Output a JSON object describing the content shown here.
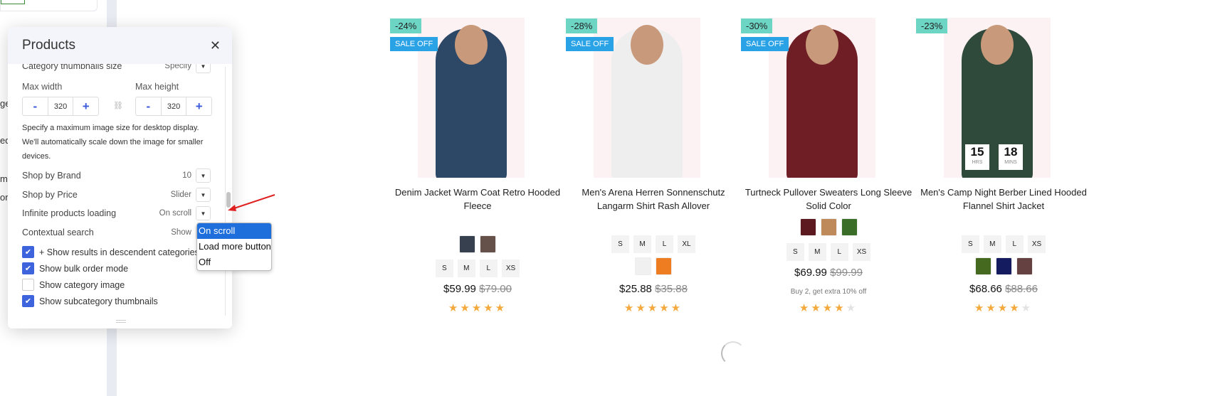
{
  "sidebar_fragments": [
    "ge",
    "ed",
    "me",
    "ori"
  ],
  "panel": {
    "title": "Products",
    "thumb_size": {
      "label": "Category thumbnails size",
      "value": "Specify"
    },
    "max_width": {
      "label": "Max width",
      "value": "320"
    },
    "max_height": {
      "label": "Max height",
      "value": "320"
    },
    "minus": "-",
    "plus": "+",
    "help": "Specify a maximum image size for desktop display. We'll automatically scale down the image for smaller devices.",
    "rows": [
      {
        "label": "Shop by Brand",
        "value": "10"
      },
      {
        "label": "Shop by Price",
        "value": "Slider"
      },
      {
        "label": "Infinite products loading",
        "value": "On scroll"
      },
      {
        "label": "Contextual search",
        "value": "Show"
      }
    ],
    "checks": [
      {
        "label": "+ Show results in descendent categories",
        "checked": true
      },
      {
        "label": "Show bulk order mode",
        "checked": true
      },
      {
        "label": "Show category image",
        "checked": false
      },
      {
        "label": "Show subcategory thumbnails",
        "checked": true
      }
    ],
    "dropdown_options": [
      "On scroll",
      "Load more button",
      "Off"
    ],
    "dropdown_selected": "On scroll"
  },
  "colors": {
    "accent": "#3d63dd",
    "discount_badge": "#6dd5c4",
    "sale_badge": "#2aa2e6",
    "star": "#f4a93c",
    "selected_option": "#1e6fdc"
  },
  "products": [
    {
      "discount": "-24%",
      "sale": "SALE OFF",
      "name": "Denim Jacket Warm Coat Retro Hooded Fleece",
      "colors": [
        "#36404f",
        "#65504a"
      ],
      "sizes": [
        "S",
        "M",
        "L",
        "XS"
      ],
      "order": "colors-first",
      "price": "$59.99",
      "old_price": "$79.00",
      "rating": 5,
      "garment": "#2d4766"
    },
    {
      "discount": "-28%",
      "sale": "SALE OFF",
      "name": "Men's Arena Herren Sonnenschutz Langarm Shirt Rash Allover",
      "sizes": [
        "S",
        "M",
        "L",
        "XL"
      ],
      "colors": [
        "#f0f0f0",
        "#ee7d22"
      ],
      "order": "sizes-first",
      "price": "$25.88",
      "old_price": "$35.88",
      "rating": 5,
      "garment": "#eeeeee"
    },
    {
      "discount": "-30%",
      "sale": "SALE OFF",
      "name": "Turtneck Pullover Sweaters Long Sleeve Solid Color",
      "colors": [
        "#5c1a20",
        "#bf8a5a",
        "#3a6e28"
      ],
      "sizes": [
        "S",
        "M",
        "L",
        "XS"
      ],
      "order": "colors-first",
      "price": "$69.99",
      "old_price": "$99.99",
      "promo": "Buy 2, get extra 10% off",
      "rating": 4,
      "garment": "#6e1e24"
    },
    {
      "discount": "-23%",
      "name": "Men's Camp Night Berber Lined Hooded Flannel Shirt Jacket",
      "sizes": [
        "S",
        "M",
        "L",
        "XS"
      ],
      "colors": [
        "#44691f",
        "#141b5e",
        "#654241"
      ],
      "order": "sizes-first",
      "price": "$68.66",
      "old_price": "$88.66",
      "rating": 4,
      "garment": "#2f4a3a",
      "countdown": [
        {
          "value": "15",
          "unit": "HRS"
        },
        {
          "value": "18",
          "unit": "MINS"
        }
      ]
    }
  ]
}
